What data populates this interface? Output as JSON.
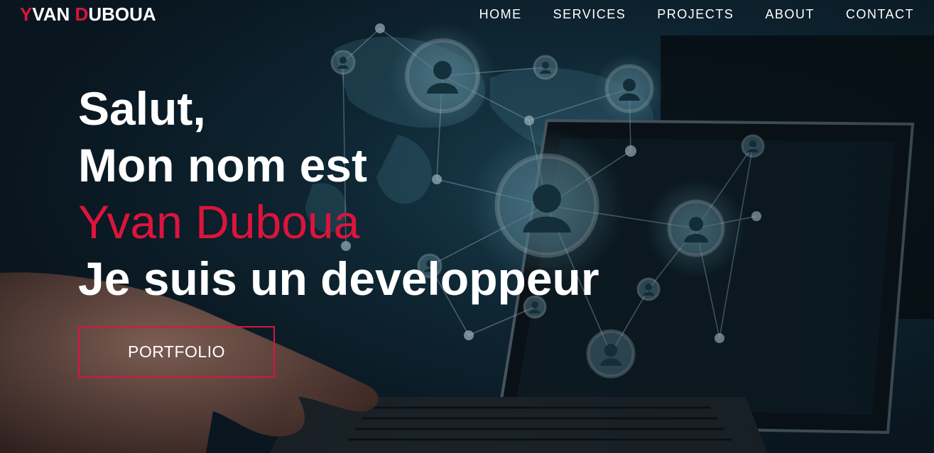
{
  "theme": {
    "accent": "#dc143c",
    "text": "#ffffff",
    "background": "#0f2230"
  },
  "brand": {
    "first_initial": "Y",
    "first_rest": "VAN",
    "last_initial": "D",
    "last_rest": "UBOUA"
  },
  "nav": {
    "items": [
      {
        "label": "HOME"
      },
      {
        "label": "SERVICES"
      },
      {
        "label": "PROJECTS"
      },
      {
        "label": "ABOUT"
      },
      {
        "label": "CONTACT"
      }
    ]
  },
  "hero": {
    "greeting": "Salut,",
    "intro": "Mon nom est",
    "name": "Yvan Duboua",
    "role": "Je suis un developpeur",
    "button_label": "PORTFOLIO"
  },
  "background_icons": [
    "network-node-icon",
    "user-icon",
    "laptop-icon",
    "hand-icon"
  ]
}
